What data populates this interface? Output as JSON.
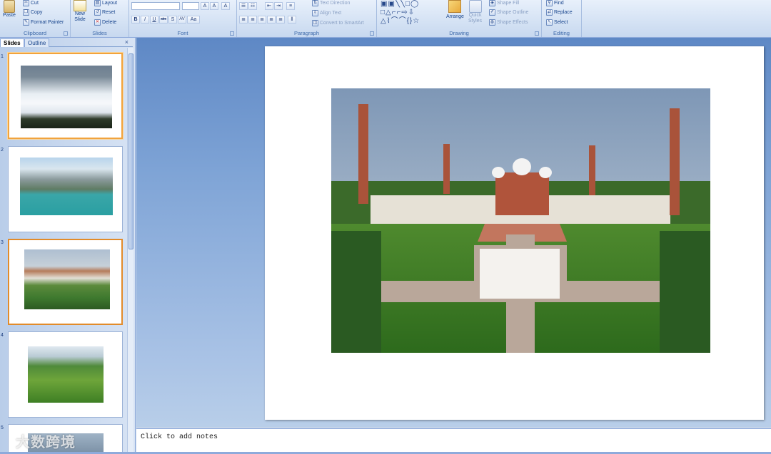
{
  "ribbon": {
    "clipboard": {
      "label": "Clipboard",
      "paste": "Paste",
      "cut": "Cut",
      "copy": "Copy",
      "format_painter": "Format Painter"
    },
    "slides": {
      "label": "Slides",
      "new_slide_1": "New",
      "new_slide_2": "Slide",
      "layout": "Layout",
      "reset": "Reset",
      "delete": "Delete"
    },
    "font": {
      "label": "Font",
      "bold": "B",
      "italic": "I",
      "underline": "U",
      "strike": "abc",
      "shadow": "S",
      "spacing": "AV",
      "case": "Aa",
      "grow": "A",
      "shrink": "A",
      "clear": "A"
    },
    "paragraph": {
      "label": "Paragraph",
      "text_direction": "Text Direction",
      "align_text": "Align Text",
      "smartart": "Convert to SmartArt"
    },
    "drawing": {
      "label": "Drawing",
      "arrange": "Arrange",
      "quick_styles_1": "Quick",
      "quick_styles_2": "Styles",
      "shape_fill": "Shape Fill",
      "shape_outline": "Shape Outline",
      "shape_effects": "Shape Effects"
    },
    "editing": {
      "label": "Editing",
      "find": "Find",
      "replace": "Replace",
      "select": "Select"
    }
  },
  "panel": {
    "tab_slides": "Slides",
    "tab_outline": "Outline",
    "close": "×"
  },
  "thumbnails": [
    {
      "num": "1",
      "desc": "snow-hills"
    },
    {
      "num": "2",
      "desc": "mountain-lake"
    },
    {
      "num": "3",
      "desc": "mosque"
    },
    {
      "num": "4",
      "desc": "green-valley"
    },
    {
      "num": "5",
      "desc": "partial"
    }
  ],
  "notes": {
    "placeholder": "Click to add notes"
  },
  "watermark": "大数跨境"
}
